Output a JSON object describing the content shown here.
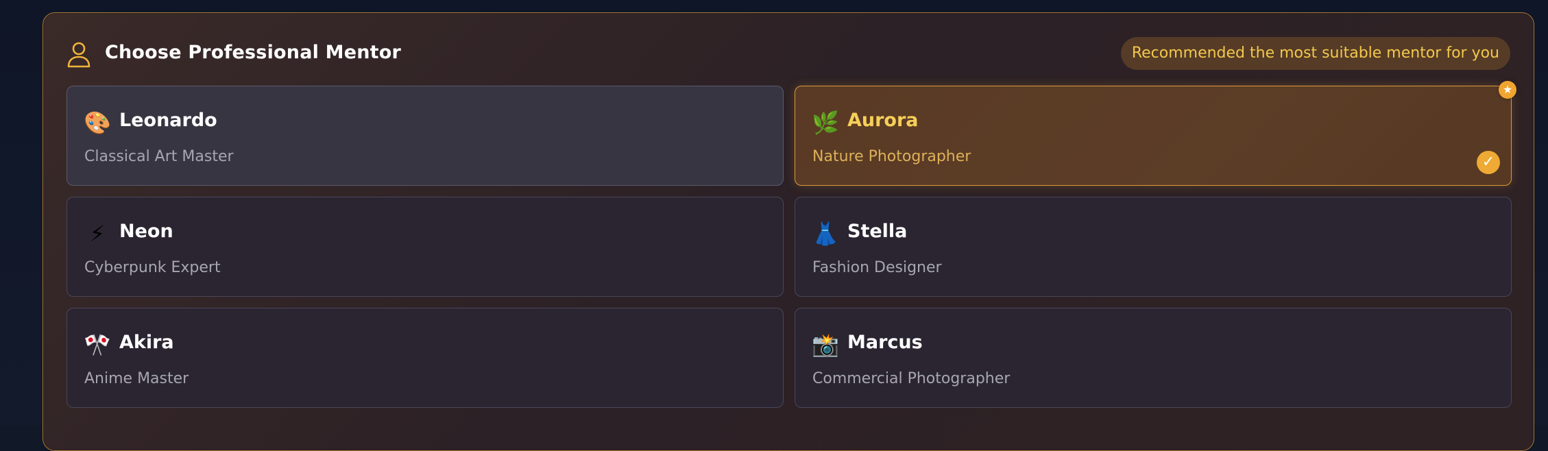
{
  "header": {
    "title": "Choose Professional Mentor",
    "icon": "user-icon",
    "badge": "Recommended the most suitable mentor for you"
  },
  "colors": {
    "accent": "#eeaa34",
    "accent_text": "#f3c84d",
    "selected_border": "#d99a3a",
    "card_bg": "#2a2531"
  },
  "mentors": [
    {
      "emoji": "🎨",
      "icon": "palette-icon",
      "name": "Leonardo",
      "role": "Classical Art Master",
      "state": "hover"
    },
    {
      "emoji": "🌿",
      "icon": "herb-icon",
      "name": "Aurora",
      "role": "Nature Photographer",
      "state": "selected",
      "recommended": true
    },
    {
      "emoji": "⚡",
      "icon": "lightning-icon",
      "name": "Neon",
      "role": "Cyberpunk Expert",
      "state": "default"
    },
    {
      "emoji": "👗",
      "icon": "dress-icon",
      "name": "Stella",
      "role": "Fashion Designer",
      "state": "default"
    },
    {
      "emoji": "🎌",
      "icon": "crossed-flags-icon",
      "name": "Akira",
      "role": "Anime Master",
      "state": "default"
    },
    {
      "emoji": "📸",
      "icon": "camera-flash-icon",
      "name": "Marcus",
      "role": "Commercial Photographer",
      "state": "default"
    }
  ],
  "selected_mark": "✓",
  "recommended_mark": "★"
}
